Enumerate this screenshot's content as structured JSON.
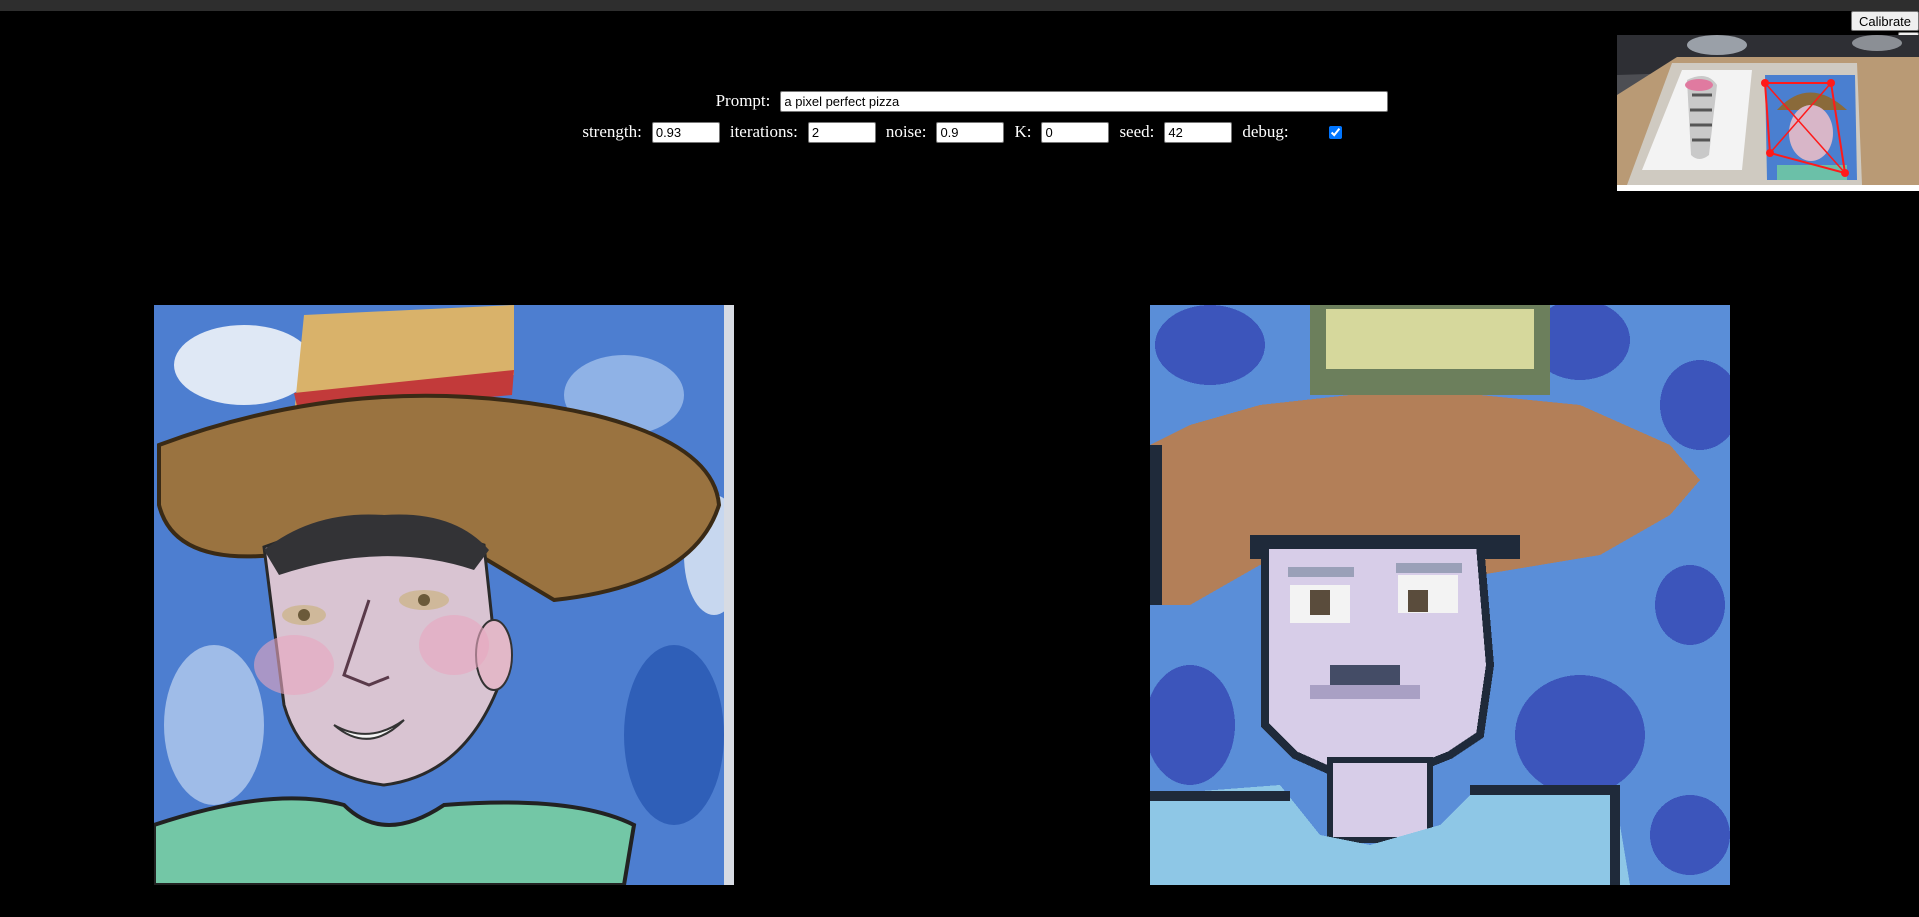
{
  "prompt": {
    "label": "Prompt:",
    "value": "a pixel perfect pizza"
  },
  "params": {
    "strength": {
      "label": "strength:",
      "value": "0.93"
    },
    "iterations": {
      "label": "iterations:",
      "value": "2"
    },
    "noise": {
      "label": "noise:",
      "value": "0.9"
    },
    "k": {
      "label": "K:",
      "value": "0"
    },
    "seed": {
      "label": "seed:",
      "value": "42"
    },
    "debug": {
      "label": "debug:",
      "checked": true
    }
  },
  "buttons": {
    "calibrate": "Calibrate",
    "help": "?"
  },
  "colors": {
    "background": "#000000",
    "checkbox_accent": "#0075ff",
    "calibration_marker": "#ff1a1a"
  }
}
